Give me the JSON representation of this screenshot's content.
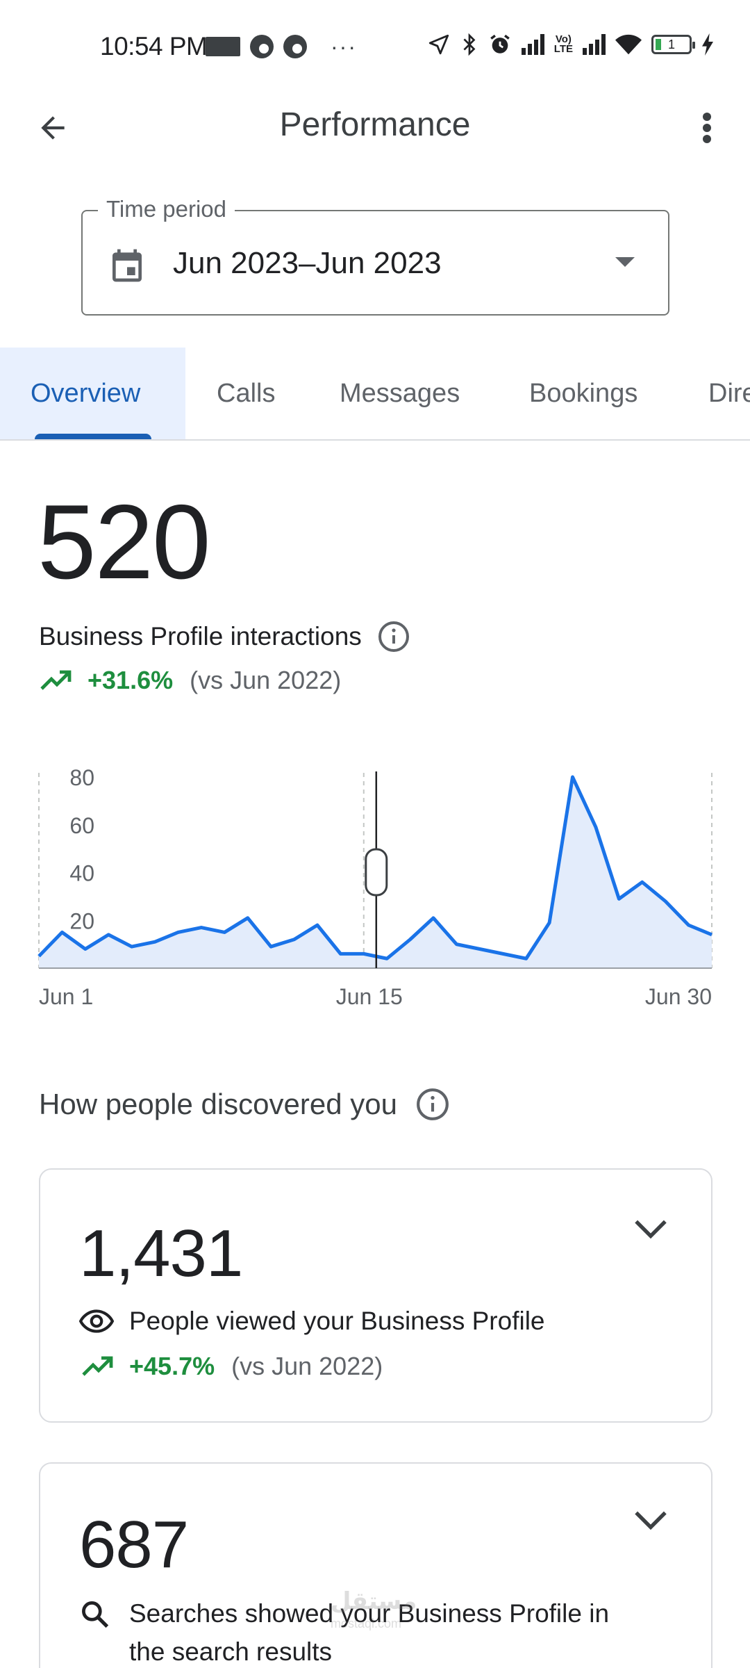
{
  "status_bar": {
    "time": "10:54 PM",
    "battery": "1",
    "network": "LTE"
  },
  "appbar": {
    "title": "Performance"
  },
  "time_period": {
    "label": "Time period",
    "value": "Jun 2023–Jun 2023"
  },
  "tabs": [
    {
      "label": "Overview",
      "active": true
    },
    {
      "label": "Calls",
      "active": false
    },
    {
      "label": "Messages",
      "active": false
    },
    {
      "label": "Bookings",
      "active": false
    },
    {
      "label": "Dire",
      "active": false
    }
  ],
  "interactions": {
    "value": "520",
    "label": "Business Profile interactions",
    "trend_pct": "+31.6%",
    "trend_vs": "(vs Jun 2022)"
  },
  "chart_data": {
    "type": "area",
    "x_labels": [
      "Jun 1",
      "Jun 15",
      "Jun 30"
    ],
    "yticks": [
      20,
      40,
      60,
      80
    ],
    "ylim": [
      0,
      80
    ],
    "x": [
      1,
      2,
      3,
      4,
      5,
      6,
      7,
      8,
      9,
      10,
      11,
      12,
      13,
      14,
      15,
      16,
      17,
      18,
      19,
      20,
      21,
      22,
      23,
      24,
      25,
      26,
      27,
      28,
      29,
      30
    ],
    "values": [
      5,
      15,
      8,
      14,
      9,
      11,
      15,
      17,
      15,
      21,
      9,
      12,
      18,
      6,
      6,
      4,
      12,
      21,
      10,
      8,
      6,
      4,
      19,
      80,
      59,
      29,
      36,
      28,
      18,
      14
    ],
    "highlight": "Jun 15",
    "colors": {
      "line": "#1a73e8",
      "fill": "#e3ecfb"
    }
  },
  "discovery": {
    "title": "How people discovered you",
    "cards": [
      {
        "value": "1,431",
        "label": "People viewed your Business Profile",
        "trend_pct": "+45.7%",
        "trend_vs": "(vs Jun 2022)"
      },
      {
        "value": "687",
        "label_line1": "Searches showed your Business Profile in",
        "label_line2": "the search results"
      }
    ]
  },
  "watermark": {
    "text": "مستقل",
    "sub": "mostaql.com"
  },
  "colors": {
    "accent": "#1a5fb4",
    "positive": "#1e8e3e",
    "text_secondary": "#5f6368",
    "border": "#dadce0"
  }
}
